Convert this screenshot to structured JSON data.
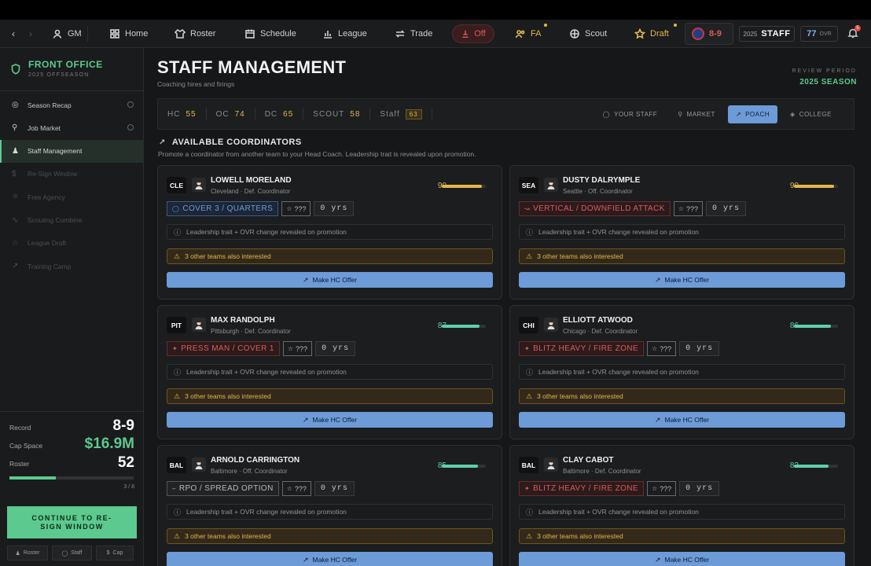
{
  "nav": {
    "gm_label": "GM",
    "items": [
      {
        "label": "Home",
        "icon": "home-icon"
      },
      {
        "label": "Roster",
        "icon": "shirt-icon"
      },
      {
        "label": "Schedule",
        "icon": "calendar-icon"
      },
      {
        "label": "League",
        "icon": "chart-icon"
      },
      {
        "label": "Trade",
        "icon": "swap-icon"
      },
      {
        "label": "Off",
        "icon": "alert-icon"
      },
      {
        "label": "FA",
        "icon": "users-icon"
      },
      {
        "label": "Scout",
        "icon": "target-icon"
      },
      {
        "label": "Draft",
        "icon": "star-icon"
      }
    ],
    "record": "8-9",
    "season_year": "2025",
    "staff_label": "STAFF",
    "ovr_value": "77",
    "ovr_label": "OVR",
    "notification_count": "5"
  },
  "sidebar": {
    "title": "FRONT OFFICE",
    "subtitle": "2025 OFFSEASON",
    "items": [
      {
        "label": "Season Recap",
        "state": "done"
      },
      {
        "label": "Job Market",
        "state": "done"
      },
      {
        "label": "Staff Management",
        "state": "active"
      },
      {
        "label": "Re-Sign Window",
        "state": "locked"
      },
      {
        "label": "Free Agency",
        "state": "locked"
      },
      {
        "label": "Scouting Combine",
        "state": "locked"
      },
      {
        "label": "League Draft",
        "state": "locked"
      },
      {
        "label": "Training Camp",
        "state": "locked"
      }
    ],
    "stats": {
      "record_label": "Record",
      "record_value": "8-9",
      "cap_label": "Cap Space",
      "cap_value": "$16.9M",
      "roster_label": "Roster",
      "roster_value": "52",
      "progress": 0.375,
      "progress_label": "3 / 8"
    },
    "cta": "CONTINUE TO RE-SIGN WINDOW",
    "mini_buttons": [
      "Roster",
      "Staff",
      "Cap"
    ]
  },
  "page": {
    "title": "STAFF MANAGEMENT",
    "subtitle": "Coaching hires and firings",
    "review_label": "REVIEW PERIOD",
    "review_value": "2025 SEASON"
  },
  "ratings": [
    {
      "label": "HC",
      "value": "55"
    },
    {
      "label": "OC",
      "value": "74"
    },
    {
      "label": "DC",
      "value": "65"
    },
    {
      "label": "SCOUT",
      "value": "58"
    }
  ],
  "staff_label": "Staff",
  "staff_value": "63",
  "tabs": [
    "YOUR STAFF",
    "MARKET",
    "POACH",
    "COLLEGE"
  ],
  "active_tab": "POACH",
  "section": {
    "title": "AVAILABLE COORDINATORS",
    "subtitle": "Promote a coordinator from another team to your Head Coach. Leadership trait is revealed upon promotion."
  },
  "colors": {
    "accent": "#5cc98f",
    "blue": "#6c9bd8",
    "gold": "#e2b74c",
    "teal": "#5fd0a8",
    "red": "#e05a55"
  },
  "coordinators": [
    {
      "team": "CLE",
      "name": "LOWELL MORELAND",
      "city": "Cleveland",
      "role": "Def. Coordinator",
      "score": 90,
      "scheme": "COVER 3 / QUARTERS",
      "scheme_color": "blue",
      "scheme_icon": "shield-icon",
      "trait": "???",
      "years": "0 yrs",
      "info": "Leadership trait + OVR change revealed on promotion",
      "interest": "3 other teams also interested",
      "offer": "Make HC Offer"
    },
    {
      "team": "SEA",
      "name": "DUSTY DALRYMPLE",
      "city": "Seattle",
      "role": "Off. Coordinator",
      "score": 90,
      "scheme": "VERTICAL / DOWNFIELD ATTACK",
      "scheme_color": "red",
      "scheme_icon": "trend-icon",
      "trait": "???",
      "years": "0 yrs",
      "info": "Leadership trait + OVR change revealed on promotion",
      "interest": "3 other teams also interested",
      "offer": "Make HC Offer"
    },
    {
      "team": "PIT",
      "name": "MAX RANDOLPH",
      "city": "Pittsburgh",
      "role": "Def. Coordinator",
      "score": 87,
      "scheme": "PRESS MAN / COVER 1",
      "scheme_color": "red",
      "scheme_icon": "bolt-icon",
      "trait": "???",
      "years": "0 yrs",
      "info": "Leadership trait + OVR change revealed on promotion",
      "interest": "3 other teams also interested",
      "offer": "Make HC Offer"
    },
    {
      "team": "CHI",
      "name": "ELLIOTT ATWOOD",
      "city": "Chicago",
      "role": "Def. Coordinator",
      "score": 86,
      "scheme": "BLITZ HEAVY / FIRE ZONE",
      "scheme_color": "red",
      "scheme_icon": "bolt-icon",
      "trait": "???",
      "years": "0 yrs",
      "info": "Leadership trait + OVR change revealed on promotion",
      "interest": "3 other teams also interested",
      "offer": "Make HC Offer"
    },
    {
      "team": "BAL",
      "name": "ARNOLD CARRINGTON",
      "city": "Baltimore",
      "role": "Off. Coordinator",
      "score": 85,
      "scheme": "RPO / SPREAD OPTION",
      "scheme_color": "gray",
      "scheme_icon": "minus-icon",
      "trait": "???",
      "years": "0 yrs",
      "info": "Leadership trait + OVR change revealed on promotion",
      "interest": "3 other teams also interested",
      "offer": "Make HC Offer"
    },
    {
      "team": "BAL",
      "name": "CLAY CABOT",
      "city": "Baltimore",
      "role": "Def. Coordinator",
      "score": 83,
      "scheme": "BLITZ HEAVY / FIRE ZONE",
      "scheme_color": "red",
      "scheme_icon": "bolt-icon",
      "trait": "???",
      "years": "0 yrs",
      "info": "Leadership trait + OVR change revealed on promotion",
      "interest": "3 other teams also interested",
      "offer": "Make HC Offer"
    }
  ]
}
